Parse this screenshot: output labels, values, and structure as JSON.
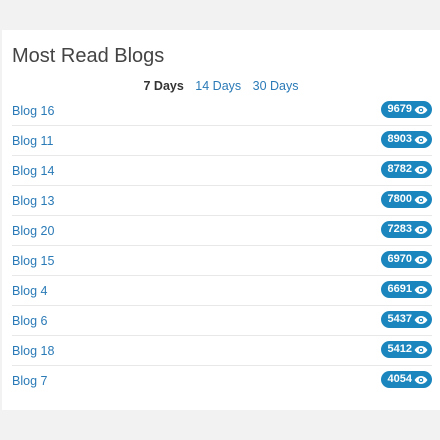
{
  "widget": {
    "title": "Most Read Blogs",
    "tabs": [
      {
        "label": "7 Days",
        "active": true
      },
      {
        "label": "14 Days",
        "active": false
      },
      {
        "label": "30 Days",
        "active": false
      }
    ],
    "items": [
      {
        "label": "Blog 16",
        "views": "9679"
      },
      {
        "label": "Blog 11",
        "views": "8903"
      },
      {
        "label": "Blog 14",
        "views": "8782"
      },
      {
        "label": "Blog 13",
        "views": "7800"
      },
      {
        "label": "Blog 20",
        "views": "7283"
      },
      {
        "label": "Blog 15",
        "views": "6970"
      },
      {
        "label": "Blog 4",
        "views": "6691"
      },
      {
        "label": "Blog 6",
        "views": "5437"
      },
      {
        "label": "Blog 18",
        "views": "5412"
      },
      {
        "label": "Blog 7",
        "views": "4054"
      }
    ]
  },
  "colors": {
    "link": "#2a7ab7",
    "badge": "#1b86bd",
    "background": "#f2f2f2"
  },
  "icons": {
    "badge_icon": "eye-icon"
  }
}
